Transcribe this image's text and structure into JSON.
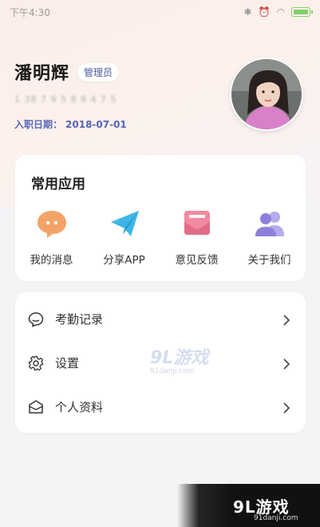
{
  "status_bar": {
    "time": "下午4:30"
  },
  "profile": {
    "name": "潘明辉",
    "role": "管理员",
    "phone": "1 38 7 9 5 8 8 4 7 5",
    "join_label": "入职日期：",
    "join_date": "2018-07-01"
  },
  "apps": {
    "title": "常用应用",
    "items": [
      {
        "label": "我的消息",
        "icon": "chat-bubble-icon",
        "color": "#f3a368"
      },
      {
        "label": "分享APP",
        "icon": "paper-plane-icon",
        "color": "#3db6e6"
      },
      {
        "label": "意见反馈",
        "icon": "envelope-icon",
        "color": "#f08aa0"
      },
      {
        "label": "关于我们",
        "icon": "people-icon",
        "color": "#9b8ce0"
      }
    ]
  },
  "menu": [
    {
      "label": "考勤记录",
      "icon": "comment-icon"
    },
    {
      "label": "设置",
      "icon": "gear-icon"
    },
    {
      "label": "个人资料",
      "icon": "mail-icon"
    }
  ],
  "watermark": {
    "mid": "9L游戏",
    "mid_sub": "91danji.com",
    "corner": "9L游戏",
    "corner_sub": "91danji.com"
  }
}
